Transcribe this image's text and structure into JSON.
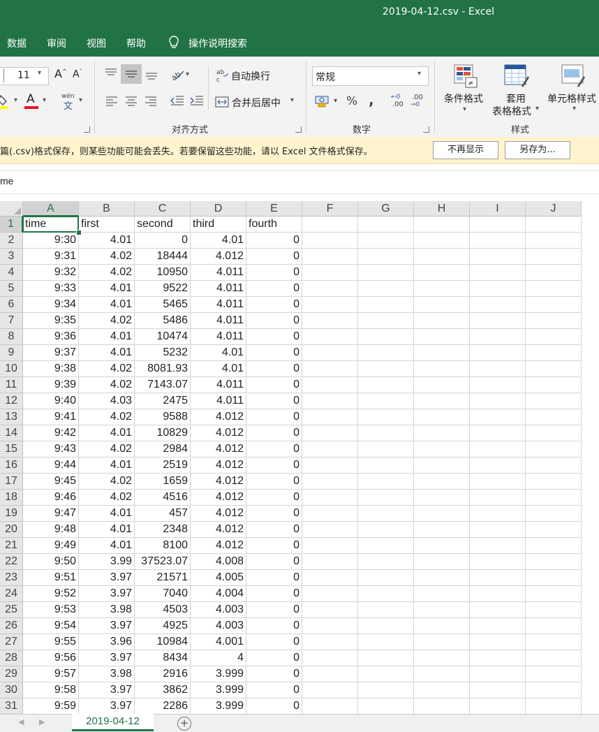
{
  "window": {
    "title": "2019-04-12.csv  -  Excel"
  },
  "ribbon_tabs": [
    "数据",
    "审阅",
    "视图",
    "帮助",
    "操作说明搜索"
  ],
  "font": {
    "size": "11"
  },
  "alignment": {
    "wrap_text": "自动换行",
    "merge_center": "合并后居中",
    "group_label": "对齐方式"
  },
  "number": {
    "format": "常规",
    "percent": "%",
    "comma": ",",
    "inc_decimal": ".00",
    "dec_decimal": ".00",
    "group_label": "数字"
  },
  "styles": {
    "conditional": "条件格式",
    "table_format_1": "套用",
    "table_format_2": "表格格式",
    "cell_styles": "单元格样式",
    "group_label": "样式"
  },
  "message": {
    "text": "篇(.csv)格式保存，则某些功能可能会丢失。若要保留这些功能，请以 Excel 文件格式保存。",
    "dont_show": "不再显示",
    "save_as": "另存为..."
  },
  "formula_bar": {
    "content": "me"
  },
  "columns": [
    "A",
    "B",
    "C",
    "D",
    "E",
    "F",
    "G",
    "H",
    "I",
    "J"
  ],
  "headers": [
    "time",
    "first",
    "second",
    "third",
    "fourth"
  ],
  "rows": [
    [
      "9:30",
      "4.01",
      "0",
      "4.01",
      "0"
    ],
    [
      "9:31",
      "4.02",
      "18444",
      "4.012",
      "0"
    ],
    [
      "9:32",
      "4.02",
      "10950",
      "4.011",
      "0"
    ],
    [
      "9:33",
      "4.01",
      "9522",
      "4.011",
      "0"
    ],
    [
      "9:34",
      "4.01",
      "5465",
      "4.011",
      "0"
    ],
    [
      "9:35",
      "4.02",
      "5486",
      "4.011",
      "0"
    ],
    [
      "9:36",
      "4.01",
      "10474",
      "4.011",
      "0"
    ],
    [
      "9:37",
      "4.01",
      "5232",
      "4.01",
      "0"
    ],
    [
      "9:38",
      "4.02",
      "8081.93",
      "4.01",
      "0"
    ],
    [
      "9:39",
      "4.02",
      "7143.07",
      "4.011",
      "0"
    ],
    [
      "9:40",
      "4.03",
      "2475",
      "4.011",
      "0"
    ],
    [
      "9:41",
      "4.02",
      "9588",
      "4.012",
      "0"
    ],
    [
      "9:42",
      "4.01",
      "10829",
      "4.012",
      "0"
    ],
    [
      "9:43",
      "4.02",
      "2984",
      "4.012",
      "0"
    ],
    [
      "9:44",
      "4.01",
      "2519",
      "4.012",
      "0"
    ],
    [
      "9:45",
      "4.02",
      "1659",
      "4.012",
      "0"
    ],
    [
      "9:46",
      "4.02",
      "4516",
      "4.012",
      "0"
    ],
    [
      "9:47",
      "4.01",
      "457",
      "4.012",
      "0"
    ],
    [
      "9:48",
      "4.01",
      "2348",
      "4.012",
      "0"
    ],
    [
      "9:49",
      "4.01",
      "8100",
      "4.012",
      "0"
    ],
    [
      "9:50",
      "3.99",
      "37523.07",
      "4.008",
      "0"
    ],
    [
      "9:51",
      "3.97",
      "21571",
      "4.005",
      "0"
    ],
    [
      "9:52",
      "3.97",
      "7040",
      "4.004",
      "0"
    ],
    [
      "9:53",
      "3.98",
      "4503",
      "4.003",
      "0"
    ],
    [
      "9:54",
      "3.97",
      "4925",
      "4.003",
      "0"
    ],
    [
      "9:55",
      "3.96",
      "10984",
      "4.001",
      "0"
    ],
    [
      "9:56",
      "3.97",
      "8434",
      "4",
      "0"
    ],
    [
      "9:57",
      "3.98",
      "2916",
      "3.999",
      "0"
    ],
    [
      "9:58",
      "3.97",
      "3862",
      "3.999",
      "0"
    ],
    [
      "9:59",
      "3.97",
      "2286",
      "3.999",
      "0"
    ]
  ],
  "sheet_tabs": {
    "active": "2019-04-12",
    "add": "+"
  },
  "colors": {
    "brand": "#217346",
    "message_bg": "#fff4ce",
    "font_color_red": "#e81123",
    "highlight_yellow": "#ffff00"
  }
}
